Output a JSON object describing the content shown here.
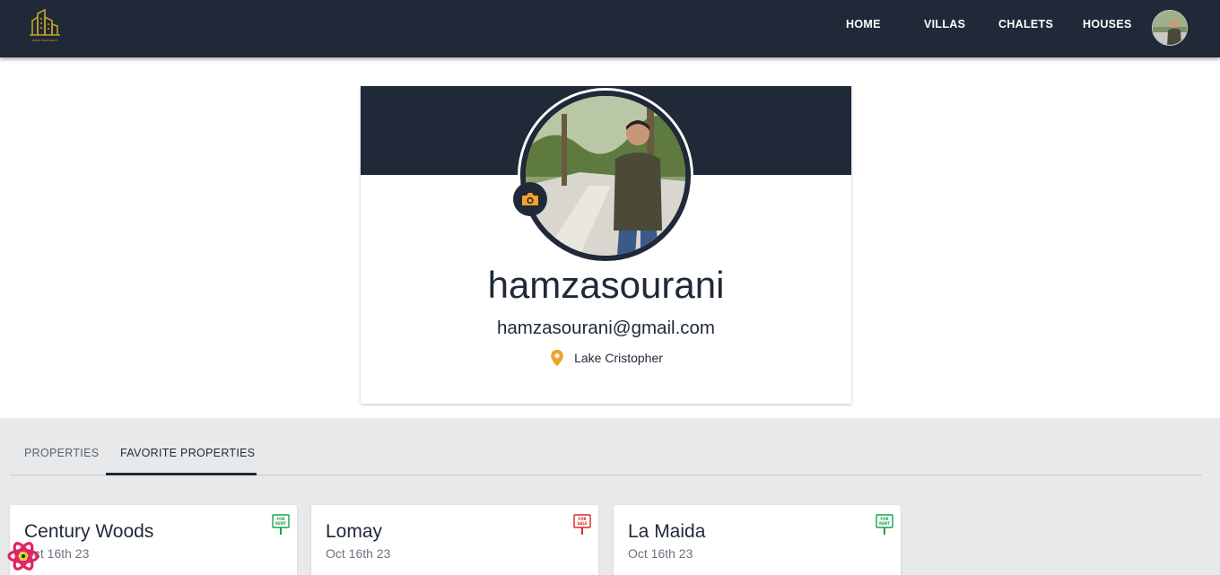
{
  "nav": {
    "items": [
      {
        "label": "HOME"
      },
      {
        "label": "VILLAS"
      },
      {
        "label": "CHALETS"
      },
      {
        "label": "HOUSES"
      }
    ],
    "logo_text": "HOME SALES RENT",
    "brand_color": "#c9a227",
    "bar_color": "#1f2937"
  },
  "profile": {
    "username": "hamzasourani",
    "email": "hamzasourani@gmail.com",
    "location": "Lake Cristopher",
    "camera_icon": "camera-icon",
    "location_icon": "map-pin-icon",
    "accent_color": "#f0a32a"
  },
  "tabs": [
    {
      "label": "PROPERTIES",
      "active": false
    },
    {
      "label": "FAVORITE PROPERTIES",
      "active": true
    }
  ],
  "properties": [
    {
      "title": "Century Woods",
      "date": "Oct 16th 23",
      "badge": "FOR RENT",
      "badge_color": "#16a34a"
    },
    {
      "title": "Lomay",
      "date": "Oct 16th 23",
      "badge": "FOR SALE",
      "badge_color": "#dc2626"
    },
    {
      "title": "La Maida",
      "date": "Oct 16th 23",
      "badge": "FOR RENT",
      "badge_color": "#16a34a"
    }
  ]
}
